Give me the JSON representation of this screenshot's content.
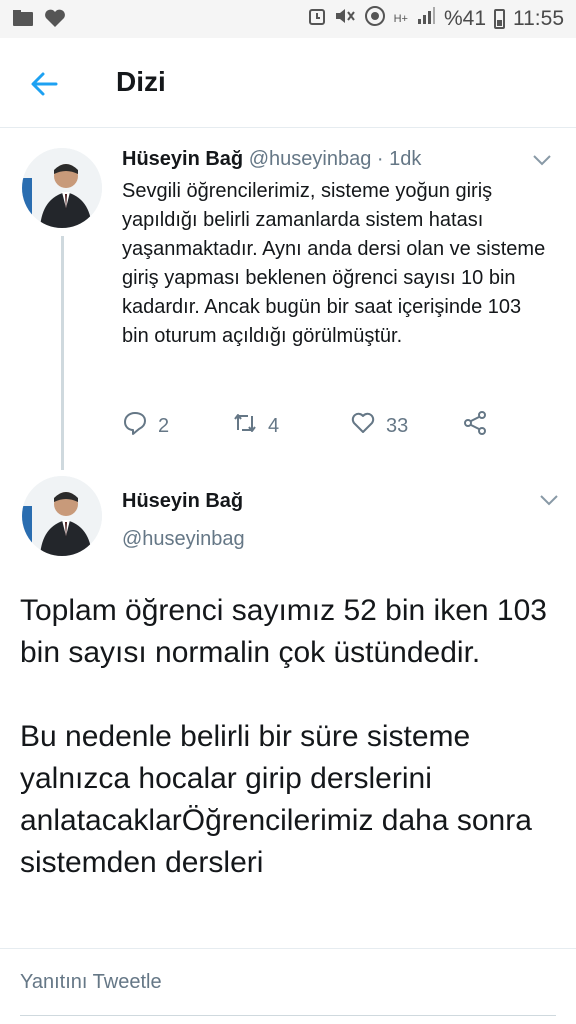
{
  "status_bar": {
    "battery_percent": "%41",
    "time": "11:55",
    "network": "H+"
  },
  "toolbar": {
    "title": "Dizi"
  },
  "tweet1": {
    "name": "Hüseyin Bağ",
    "handle": "@huseyinbag",
    "separator": " · ",
    "time": "1dk",
    "text": "Sevgili öğrencilerimiz, sisteme yoğun giriş yapıldığı belirli zamanlarda sistem hatası yaşanmaktadır. Aynı anda dersi olan ve sisteme giriş yapması beklenen öğrenci sayısı 10 bin kadardır. Ancak bugün bir saat içerişinde 103 bin oturum açıldığı görülmüştür.",
    "replies": "2",
    "retweets": "4",
    "likes": "33"
  },
  "tweet2": {
    "name": "Hüseyin Bağ",
    "handle": "@huseyinbag",
    "text": "Toplam öğrenci sayımız 52 bin iken 103 bin sayısı normalin çok üstündedir.\n\nBu nedenle belirli bir süre sisteme yalnızca hocalar girip derslerini anlatacaklarÖğrencilerimiz daha sonra sistemden dersleri"
  },
  "reply_bar": {
    "placeholder": "Yanıtını Tweetle"
  },
  "icons": [
    "image-icon",
    "heart-icon",
    "alarm-icon",
    "mute-icon",
    "wifi-icon",
    "signal-icon",
    "battery-icon",
    "back-arrow-icon",
    "chevron-down-icon",
    "reply-icon",
    "retweet-icon",
    "like-icon",
    "share-icon"
  ],
  "colors": {
    "accent": "#1da1f2",
    "text": "#14171a",
    "muted": "#657786",
    "status_bar_bg": "#f5f5f5"
  }
}
